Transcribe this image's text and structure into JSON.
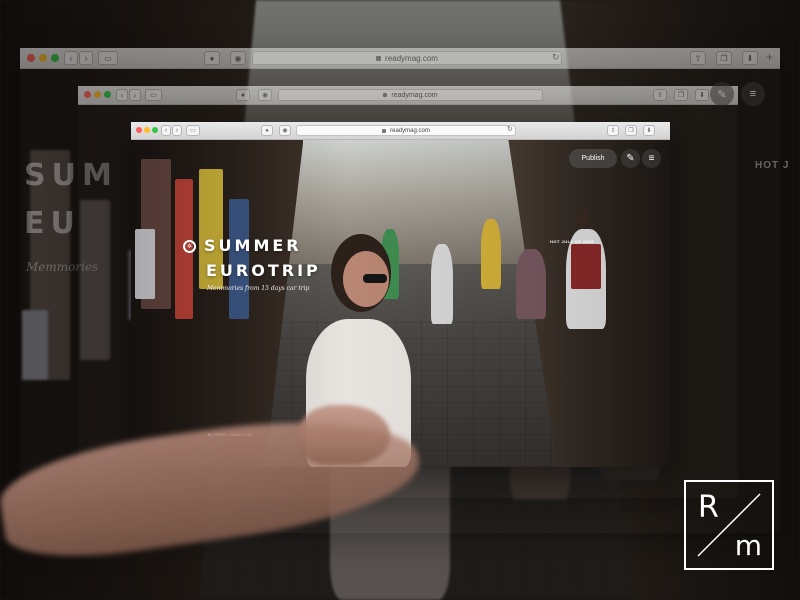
{
  "browser": {
    "url": "readymag.com"
  },
  "page": {
    "title_line1": "SUMMER",
    "title_line2": "EUROTRIP",
    "subtitle": "Memmories from 15 days car trip",
    "publish_label": "Publish",
    "tag": "HOT JULY OF 2015",
    "byline": "by PAVEL ZAMOTKIN"
  },
  "background": {
    "title_line1": "SUM",
    "title_line2": "EU",
    "subtitle": "Memmories",
    "tag": "HOT J"
  },
  "logo": {
    "letter_top": "R",
    "letter_bottom": "m"
  },
  "icons": [
    "back-arrow-icon",
    "forward-arrow-icon",
    "sidebar-icon",
    "pinterest-icon",
    "extension-icon",
    "lock-icon",
    "reload-icon",
    "share-icon",
    "tabs-icon",
    "download-icon",
    "add-tab-icon",
    "pencil-icon",
    "menu-icon",
    "aperture-icon"
  ],
  "colors": {
    "traffic_red": "#fc5f57",
    "traffic_yellow": "#fdbc2e",
    "traffic_green": "#33c748"
  }
}
